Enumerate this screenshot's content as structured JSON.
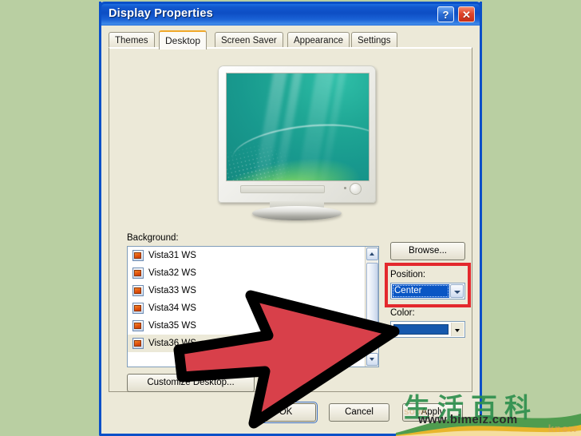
{
  "window": {
    "title": "Display Properties",
    "help_button": "?",
    "close_button": "✕"
  },
  "tabs": [
    {
      "label": "Themes",
      "active": false
    },
    {
      "label": "Desktop",
      "active": true
    },
    {
      "label": "Screen Saver",
      "active": false
    },
    {
      "label": "Appearance",
      "active": false
    },
    {
      "label": "Settings",
      "active": false
    }
  ],
  "desktop_tab": {
    "background_label": "Background:",
    "background_items": [
      "Vista31 WS",
      "Vista32 WS",
      "Vista33 WS",
      "Vista34 WS",
      "Vista35 WS",
      "Vista36 WS"
    ],
    "selected_background": "Vista36 WS",
    "browse_button": "Browse...",
    "position_label": "Position:",
    "position_value": "Center",
    "color_label": "Color:",
    "color_value": "#1558ad",
    "customize_button": "Customize Desktop..."
  },
  "footer": {
    "ok_button": "OK",
    "cancel_button": "Cancel",
    "apply_button": "Apply"
  },
  "annotations": {
    "highlight_color": "#e3282d",
    "arrow_fill": "#d8404a",
    "arrow_outline": "#000000"
  },
  "watermark": {
    "chinese": "生活百科",
    "url": "www.bimeiz.com",
    "ghost_right": "know",
    "ghost_left": "soon"
  },
  "page": {
    "background_color": "#b9cfa2"
  }
}
